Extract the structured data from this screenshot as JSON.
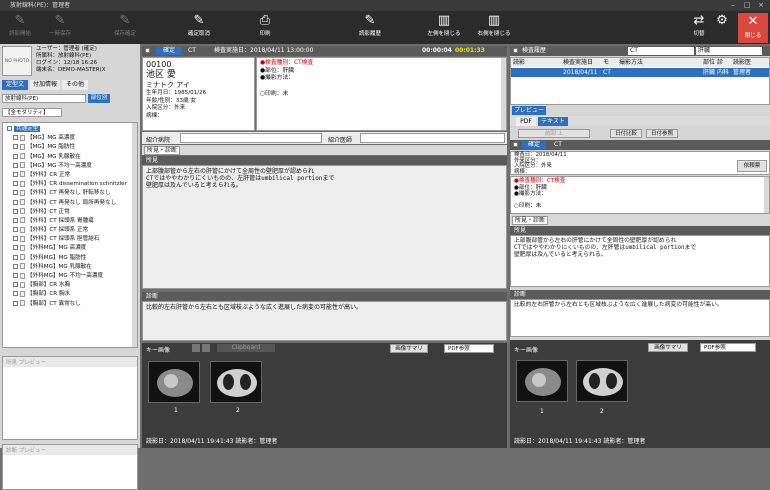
{
  "window": {
    "title": "放射線科(PE)：管理者"
  },
  "toolbar": {
    "b1": "読影開始",
    "b2": "一時保存",
    "b3": "保存確定",
    "b4": "確定取消",
    "b5": "印刷",
    "b6": "読影履歴",
    "b7": "左側を閉じる",
    "b8": "右側を閉じる",
    "b9": "切替",
    "b10": "閉じる"
  },
  "user": {
    "photo": "NO PHOTO",
    "l1": "ユーザー：",
    "v1": "管理者 (確定)",
    "l2": "所属科：",
    "v2": "放射線科(PE)",
    "l3": "ログイン：",
    "v3": "12/18 16:26",
    "l4": "端末名：",
    "v4": "DEMO-MASTER(X"
  },
  "tabs": {
    "t1": "定型文",
    "t2": "付加情報",
    "t3": "その他"
  },
  "filter": {
    "dept": "放射線科(PE)",
    "kind": "部位別",
    "modality": "【全モダリティ】"
  },
  "tree": {
    "root": "共通定型",
    "items": [
      "【MG】MG 高濃度",
      "【MG】MG 脂肪性",
      "【MG】MG 乳腺散在",
      "【MG】MG 不均一高濃度",
      "【外科】CR 正常",
      "【外科】CR dissemination schnitzler",
      "【外科】CT 再発なし 肝転移なし",
      "【外科】CT 再発なし 局所再発なし",
      "【外科】CT 正常",
      "【外科】CT 採頭系 胃腫瘍",
      "【外科】CT 採頭系 正常",
      "【外科】CT 採頭系 胆管結石",
      "【外科MG】MG 高濃度",
      "【外科MG】MG 脂肪性",
      "【外科MG】MG 乳腺散在",
      "【外科MG】MG 不均一高濃度",
      "【胸部】CR 水胸",
      "【胸部】CR 胸水",
      "【胸部】CT 異常なし"
    ]
  },
  "leftbottom": {
    "p1": "所見 プレビュー",
    "p2": "診断 プレビュー"
  },
  "center": {
    "tab1": "確定",
    "tab2": "CT",
    "date": "検査実施日：2018/04/11 13:00:00",
    "t1": "00:00:04",
    "t2": "00:01:33",
    "pid": "00100",
    "name": "池区 愛",
    "kana": "ミナトク アイ",
    "birth": "生年月日：1985/01/26",
    "age": "年齢/性別：33歳 女",
    "inout": "入院区分：外来",
    "ward": "病棟：",
    "s1": "●検査種別：CT検査",
    "s2": "●部位：肝臓",
    "s3": "●撮影方法：",
    "s4": "○印刷：未",
    "ref1": "紹介病院",
    "ref2": "紹介医師",
    "rtab": "所見・診断",
    "sec1": "所見",
    "finding": "上部腹部管から左右の肝管にかけて全周性の壁肥厚が認められ\nCTではややわかりにくいものの、左肝管はumbilical portionまで\n壁肥厚は及んでいると考えられる。",
    "sec2": "診断",
    "diagnosis": "比較的左右肝管から左右とも区域枝ぶような広く進展した病変の可能性が高い。",
    "keyimg": "キー画像",
    "clip": "Clipboard",
    "sum": "画像サマリ",
    "pdf": "PDF参照",
    "n1": "1",
    "n2": "2",
    "footer": "読影日：2018/04/11 19:41:43  読影者：管理者"
  },
  "right": {
    "hist": "検査履歴",
    "mod": "CT",
    "part": "肝臓",
    "h": [
      "読影",
      "",
      "",
      "検査実施日",
      "モ",
      "撮影方法",
      "",
      "部位",
      "診",
      "読影医"
    ],
    "row": [
      "",
      "",
      "",
      "2018/04/11",
      "CT",
      "",
      "",
      "肝臓",
      "内科",
      "管理者"
    ],
    "preview": "プレビュー",
    "pdf": "PDF",
    "text": "テキスト",
    "c1": "前回 上",
    "c2": "日付比較",
    "c3": "日付参照",
    "tab1": "確定",
    "tab2": "CT",
    "date": "検査日：2018/04/11",
    "ward": "外来区分：",
    "inout": "入院区分：外来",
    "state": "病棟：",
    "btn": "依頼票",
    "s1": "●検査種別：CT検査",
    "s2": "●部位：肝臓",
    "s3": "●撮影方法：",
    "s4": "○印刷：未",
    "rtab": "所見・診断",
    "sec1": "所見",
    "finding": "上部腹部管から左右の肝管にかけて全周性の壁肥厚が認められ\nCTではややわかりにくいものの、左肝管はumbilical portionまで\n壁肥厚は及んでいると考えられる。",
    "sec2": "診断",
    "diagnosis": "比較的左右肝管から左右とも区域枝ぶような広く進展した病変の可能性が高い。",
    "keyimg": "キー画像",
    "sum": "画像サマリ",
    "pdf2": "PDF参照",
    "n1": "1",
    "n2": "2",
    "footer": "読影日：2018/04/11 19:41:43  読影者：管理者"
  },
  "colors": {
    "accent": "#2d6fc0",
    "close": "#d9473d",
    "alert": "#d00000",
    "timer": "#e8e800"
  }
}
